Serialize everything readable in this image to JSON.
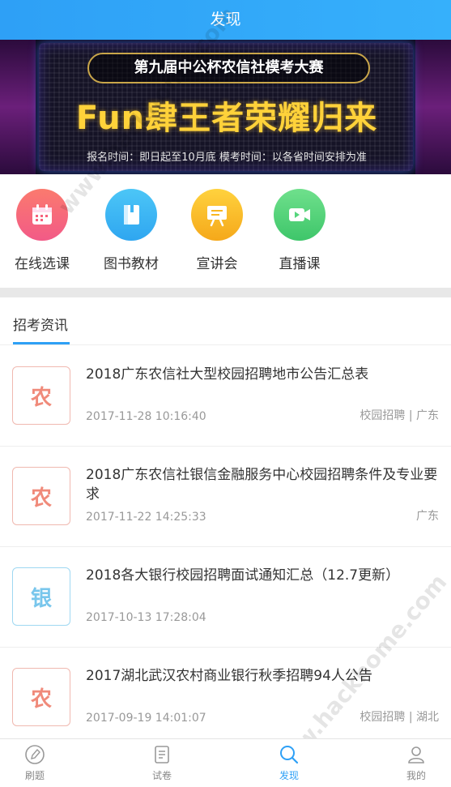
{
  "header": {
    "title": "发现"
  },
  "banner": {
    "title": "第九届中公杯农信社模考大赛",
    "headline": "Fun肆王者荣耀归来",
    "sub": "报名时间：即日起至10月底    模考时间：以各省时间安排为准"
  },
  "shortcuts": [
    {
      "label": "在线选课",
      "icon": "calendar-icon",
      "color": "#f7617c"
    },
    {
      "label": "图书教材",
      "icon": "book-icon",
      "color": "#3fb6f4"
    },
    {
      "label": "宣讲会",
      "icon": "presentation-board-icon",
      "color": "#f9b721"
    },
    {
      "label": "直播课",
      "icon": "video-camera-icon",
      "color": "#55d57c"
    }
  ],
  "section": {
    "title": "招考资讯"
  },
  "news": [
    {
      "thumb": "农",
      "title": "2018广东农信社大型校园招聘地市公告汇总表",
      "date": "2017-11-28 10:16:40",
      "tag": "校园招聘 | 广东"
    },
    {
      "thumb": "农",
      "title": "2018广东农信社银信金融服务中心校园招聘条件及专业要求",
      "date": "2017-11-22 14:25:33",
      "tag": "广东"
    },
    {
      "thumb": "银",
      "title": "2018各大银行校园招聘面试通知汇总（12.7更新）",
      "date": "2017-10-13 17:28:04",
      "tag": ""
    },
    {
      "thumb": "农",
      "title": "2017湖北武汉农村商业银行秋季招聘94人公告",
      "date": "2017-09-19 14:01:07",
      "tag": "校园招聘 | 湖北"
    }
  ],
  "tabs": [
    {
      "label": "刷题",
      "icon": "pencil-icon"
    },
    {
      "label": "试卷",
      "icon": "document-icon"
    },
    {
      "label": "发现",
      "icon": "search-icon"
    },
    {
      "label": "我的",
      "icon": "user-icon"
    }
  ],
  "watermark": {
    "text": "www.hackhome.com"
  },
  "colors": {
    "accent": "#2ea0f6",
    "thumb_red": "#f08a7a",
    "thumb_blue": "#78c6ec"
  }
}
